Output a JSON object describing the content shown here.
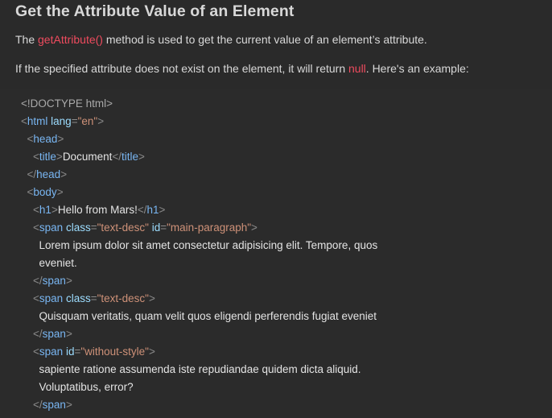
{
  "article": {
    "title": "Get the Attribute Value of an Element",
    "para1": {
      "prefix": "The ",
      "code": "getAttribute()",
      "suffix": " method is used to get the current value of an element’s attribute."
    },
    "para2": {
      "prefix": "If the specified attribute does not exist on the element, it will return ",
      "code": "null",
      "suffix": ". Here's an example:"
    }
  },
  "code": {
    "doctype": "<!DOCTYPE html>",
    "html_tag": "html",
    "html_attr": "lang",
    "html_attr_val": "\"en\"",
    "head_tag": "head",
    "title_tag": "title",
    "title_text": "Document",
    "body_tag": "body",
    "h1_tag": "h1",
    "h1_text": "Hello from Mars!",
    "span_tag": "span",
    "class_attr": "class",
    "id_attr": "id",
    "span1_class": "\"text-desc\"",
    "span1_id": "\"main-paragraph\"",
    "span1_text_line1": "Lorem ipsum dolor sit amet consectetur adipisicing elit. Tempore, quos",
    "span1_text_line2": "eveniet.",
    "span2_class": "\"text-desc\"",
    "span2_text": "Quisquam veritatis, quam velit quos eligendi perferendis fugiat eveniet",
    "span3_id": "\"without-style\"",
    "span3_text_line1": "sapiente ratione assumenda iste repudiandae quidem dicta aliquid.",
    "span3_text_line2": "Voluptatibus, error?"
  }
}
